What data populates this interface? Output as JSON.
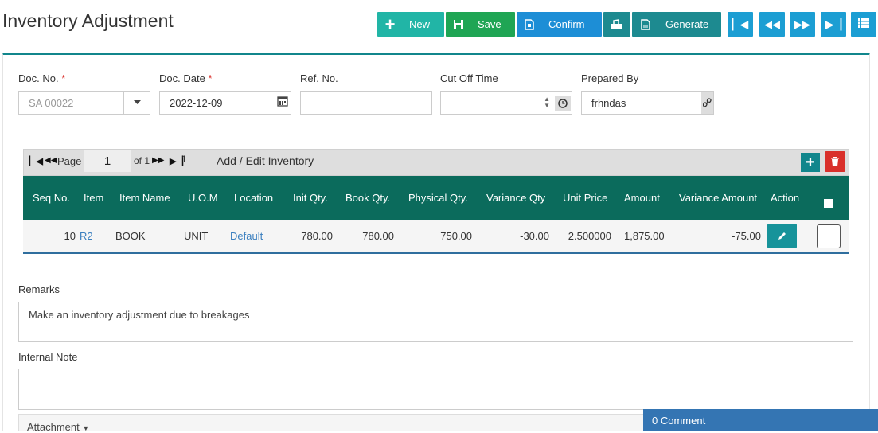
{
  "page": {
    "title": "Inventory Adjustment"
  },
  "toolbar": {
    "new_label": "New",
    "save_label": "Save",
    "confirm_label": "Confirm",
    "generate_label": "Generate"
  },
  "form": {
    "doc_no": {
      "label": "Doc. No.",
      "required_mark": "*",
      "value": "SA 00022"
    },
    "doc_date": {
      "label": "Doc. Date",
      "required_mark": "*",
      "value": "2022-12-09"
    },
    "ref_no": {
      "label": "Ref. No.",
      "value": ""
    },
    "cut_off_time": {
      "label": "Cut Off Time",
      "value": ""
    },
    "prepared_by": {
      "label": "Prepared By",
      "value": "frhndas"
    }
  },
  "grid": {
    "pager": {
      "page_label": "Page",
      "page_value": "1",
      "of_label": "of 1",
      "last_page": "1"
    },
    "title": "Add / Edit Inventory",
    "columns": [
      "Seq No.",
      "Item",
      "Item Name",
      "U.O.M",
      "Location",
      "Init Qty.",
      "Book Qty.",
      "Physical Qty.",
      "Variance Qty",
      "Unit Price",
      "Amount",
      "Variance Amount",
      "Action"
    ],
    "rows": [
      {
        "seq": "10",
        "item": "R2",
        "item_name": "BOOK",
        "uom": "UNIT",
        "location": "Default",
        "init_qty": "780.00",
        "book_qty": "780.00",
        "physical_qty": "750.00",
        "variance_qty": "-30.00",
        "unit_price": "2.500000",
        "amount": "1,875.00",
        "variance_amount": "-75.00"
      }
    ]
  },
  "remarks": {
    "label": "Remarks",
    "value": "Make an inventory adjustment due to breakages"
  },
  "internal_note": {
    "label": "Internal Note",
    "value": ""
  },
  "attachment": {
    "label": "Attachment"
  },
  "comment": {
    "label": "0 Comment"
  },
  "colors": {
    "accent": "#0b6b5c",
    "teal": "#21b5a6",
    "green": "#1fa554",
    "blue": "#1d8ed6",
    "danger": "#d9302b"
  }
}
